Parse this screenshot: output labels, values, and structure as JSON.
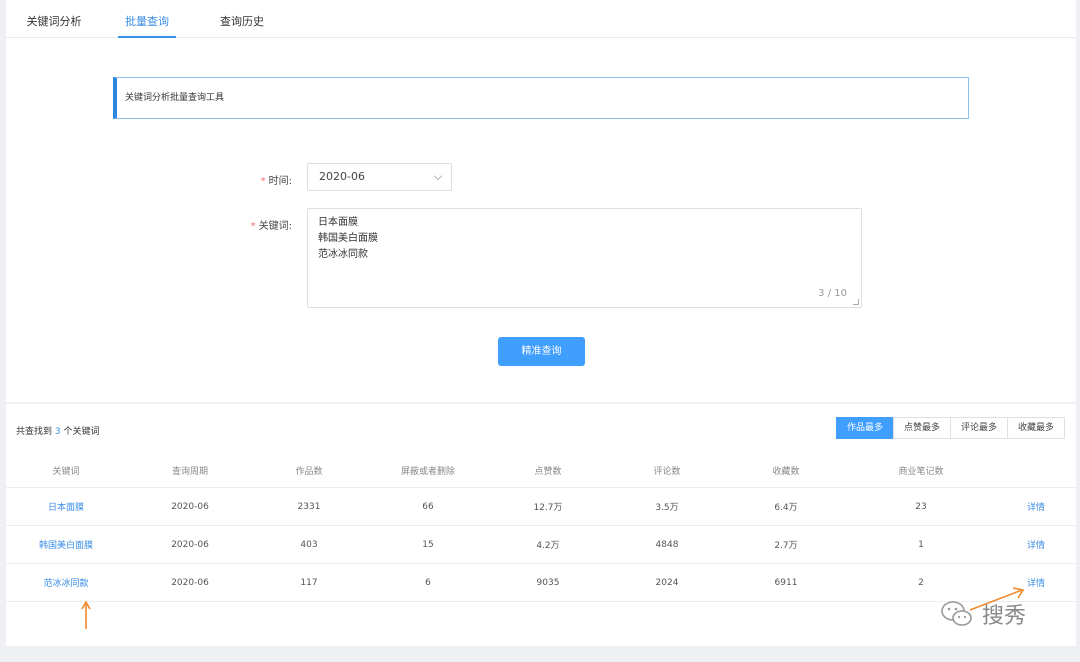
{
  "tabs": [
    {
      "label": "关键词分析"
    },
    {
      "label": "批量查询"
    },
    {
      "label": "查询历史"
    }
  ],
  "notice": {
    "text": "关键词分析批量查询工具"
  },
  "form": {
    "time_label": "时间:",
    "time_value": "2020-06",
    "keyword_label": "关键词:",
    "keywords": [
      "日本面膜",
      "韩国美白面膜",
      "范冰冰同款"
    ],
    "counter": "3 / 10",
    "submit_label": "精准查询"
  },
  "results": {
    "summary_prefix": "共查找到",
    "summary_count": "3",
    "summary_suffix": "个关键词",
    "sort_buttons": [
      {
        "label": "作品最多"
      },
      {
        "label": "点赞最多"
      },
      {
        "label": "评论最多"
      },
      {
        "label": "收藏最多"
      }
    ],
    "columns": [
      "关键词",
      "查询周期",
      "作品数",
      "屏蔽或者删除",
      "点赞数",
      "评论数",
      "收藏数",
      "商业笔记数",
      ""
    ],
    "rows": [
      {
        "keyword": "日本面膜",
        "period": "2020-06",
        "works": "2331",
        "blocked": "66",
        "likes": "12.7万",
        "comments": "3.5万",
        "favorites": "6.4万",
        "business": "23",
        "action": "详情"
      },
      {
        "keyword": "韩国美白面膜",
        "period": "2020-06",
        "works": "403",
        "blocked": "15",
        "likes": "4.2万",
        "comments": "4848",
        "favorites": "2.7万",
        "business": "1",
        "action": "详情"
      },
      {
        "keyword": "范冰冰同款",
        "period": "2020-06",
        "works": "117",
        "blocked": "6",
        "likes": "9035",
        "comments": "2024",
        "favorites": "6911",
        "business": "2",
        "action": "详情"
      }
    ]
  },
  "watermark": {
    "text": "搜秀",
    "icon": "wechat-icon"
  },
  "colors": {
    "primary": "#409eff",
    "annotation_arrow": "#f0892a"
  }
}
